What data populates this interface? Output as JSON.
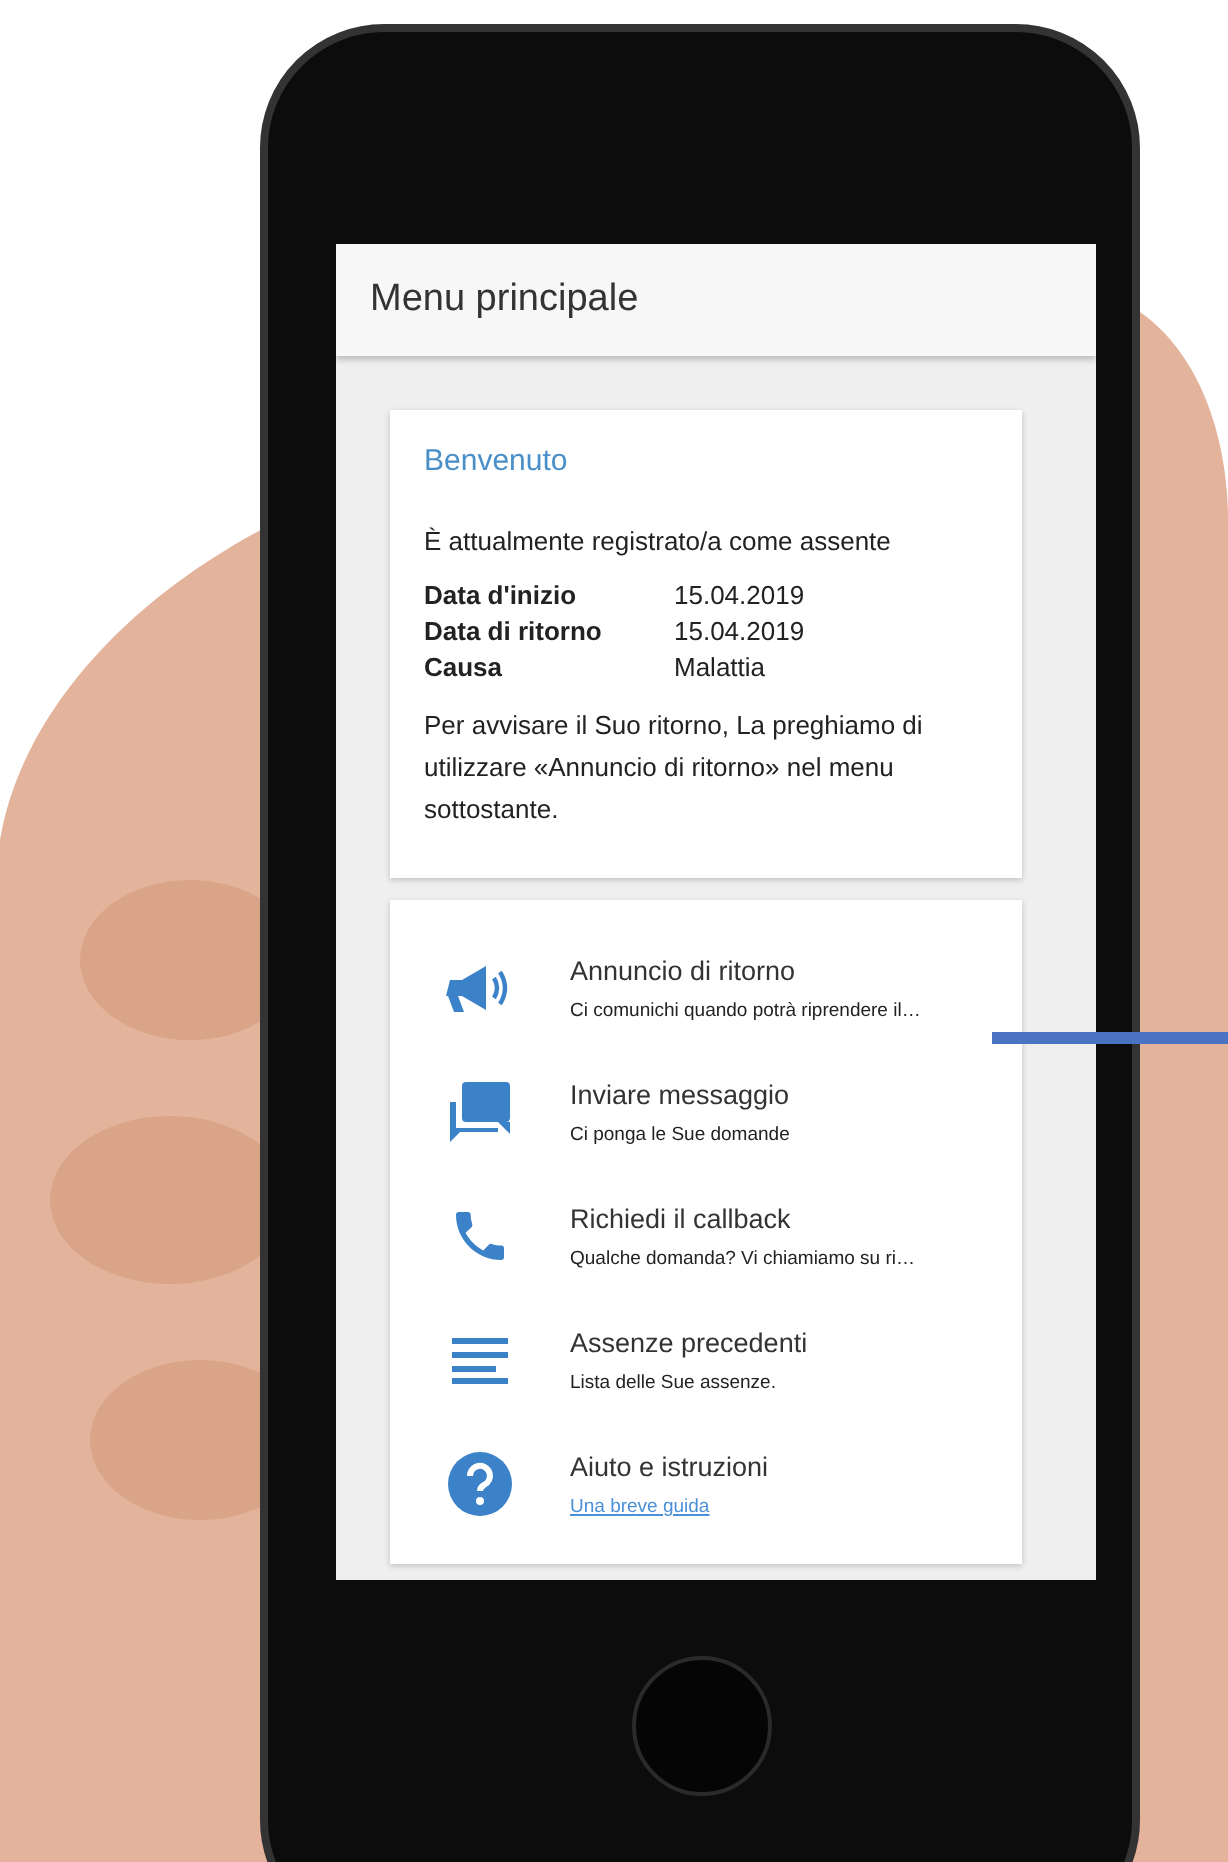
{
  "screen_title": "Menu principale",
  "welcome": {
    "title": "Benvenuto",
    "status": "È attualmente registrato/a come assente",
    "details": [
      {
        "label": "Data d'inizio",
        "value": "15.04.2019"
      },
      {
        "label": "Data di ritorno",
        "value": "15.04.2019"
      },
      {
        "label": "Causa",
        "value": "Malattia"
      }
    ],
    "note": "Per avvisare il Suo ritorno, La preghiamo di utilizzare «Annuncio di ritorno» nel menu sottostante."
  },
  "menu": [
    {
      "kind": "megaphone",
      "title": "Annuncio di ritorno",
      "subtitle": "Ci comunichi quando potrà riprendere il…",
      "link": false
    },
    {
      "kind": "chat",
      "title": "Inviare messaggio",
      "subtitle": "Ci ponga le Sue domande",
      "link": false
    },
    {
      "kind": "phone",
      "title": "Richiedi il callback",
      "subtitle": "Qualche domanda? Vi chiamiamo su ri…",
      "link": false
    },
    {
      "kind": "list",
      "title": "Assenze precedenti",
      "subtitle": "Lista delle Sue assenze.",
      "link": false
    },
    {
      "kind": "help",
      "title": "Aiuto e istruzioni",
      "subtitle": "Una breve guida",
      "link": true
    }
  ]
}
